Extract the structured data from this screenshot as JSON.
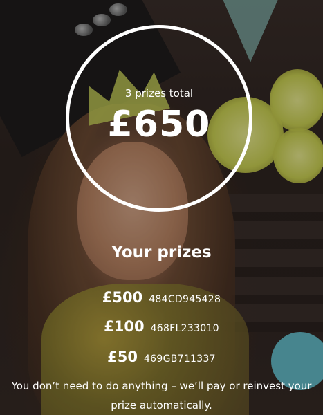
{
  "summary": {
    "prize_count_text": "3 prizes total",
    "total_amount": "£650"
  },
  "prizes_section": {
    "title": "Your prizes",
    "items": [
      {
        "amount": "£500",
        "code": "484CD945428"
      },
      {
        "amount": "£100",
        "code": "468FL233010"
      },
      {
        "amount": "£50",
        "code": "469GB711337"
      }
    ]
  },
  "notice": "You don’t need to do anything – we’ll pay or reinvest your prize automatically.",
  "colors": {
    "text": "#ffffff",
    "ring": "#ffffff"
  }
}
